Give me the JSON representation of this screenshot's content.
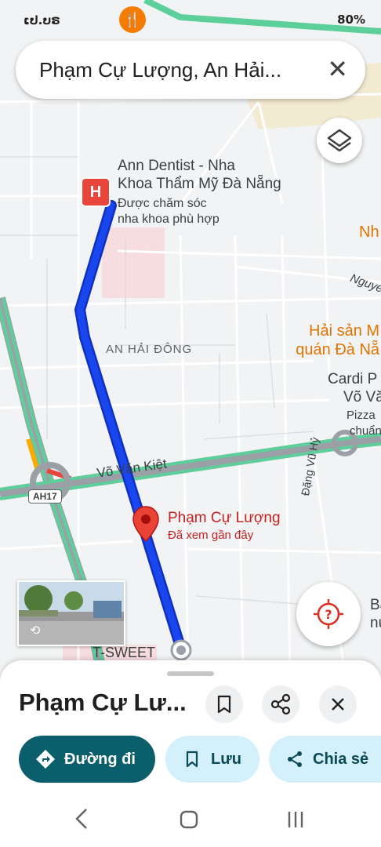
{
  "status_bar": {
    "time": "ເປ.ບຣ",
    "right": "80%"
  },
  "search": {
    "query": "Phạm Cự Lượng, An Hải..."
  },
  "map": {
    "poi_dentist": {
      "name": "Ann Dentist - Nha Khoa Thẩm Mỹ Đà Nẵng",
      "name_line1": "Ann Dentist - Nha",
      "name_line2": "Khoa Thẩm Mỹ Đà Nẵng",
      "sub_line1": "Được chăm sóc",
      "sub_line2": "nha khoa phù hợp",
      "marker": "H"
    },
    "district": "AN HẢI ĐÔNG",
    "street_vvk": "Võ Văn Kiệt",
    "street_nguyen": "Nguye",
    "street_dang": "Đặng Vũ Hỷ",
    "highway": "AH17",
    "places": {
      "nh": "Nh",
      "hai_san_1": "Hải sản M",
      "hai_san_2": "quán Đà Nẵ",
      "cardi_1": "Cardi P",
      "cardi_2": "Võ Vă",
      "pizza_1": "Pizza",
      "pizza_2": "chuẩn",
      "ba_1": "Ba",
      "ba_2": "nu"
    },
    "pin": {
      "title": "Phạm Cự Lượng",
      "subtitle": "Đã xem gần đây"
    },
    "tsweet": "T-SWEET"
  },
  "sheet": {
    "title": "Phạm Cự Lư...",
    "directions_label": "Đường đi",
    "save_label": "Lưu",
    "share_label": "Chia sẻ"
  },
  "colors": {
    "route": "#1a46f0",
    "accent": "#0b5e6b",
    "chip_bg": "#d3f0fb",
    "pin": "#ea4335"
  }
}
